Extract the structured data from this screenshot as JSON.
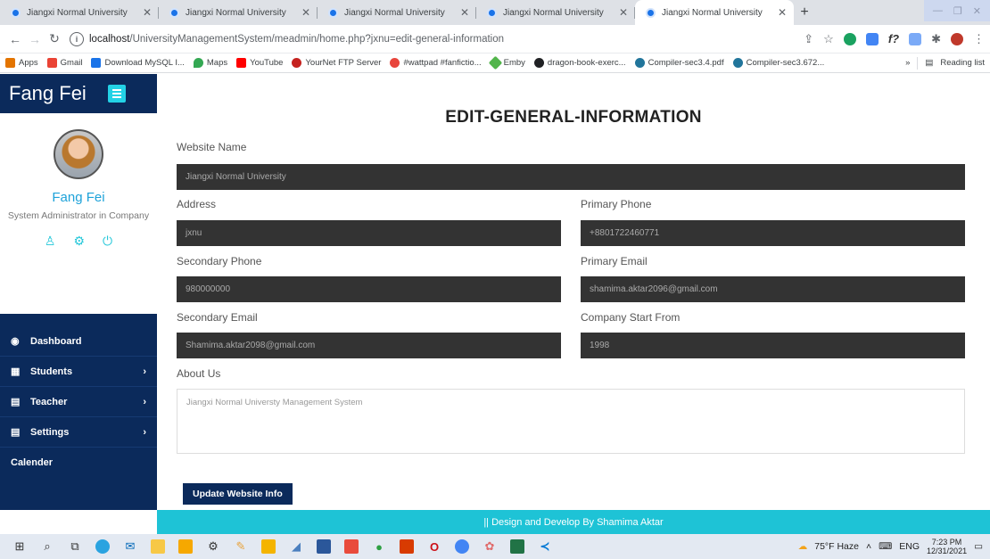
{
  "browser": {
    "tabs": [
      {
        "title": "Jiangxi Normal University",
        "active": false
      },
      {
        "title": "Jiangxi Normal University",
        "active": false
      },
      {
        "title": "Jiangxi Normal University",
        "active": false
      },
      {
        "title": "Jiangxi Normal University",
        "active": false
      },
      {
        "title": "Jiangxi Normal University",
        "active": true
      }
    ],
    "url_host": "localhost",
    "url_path": "/UniversityManagementSystem/meadmin/home.php?jxnu=edit-general-information",
    "bookmarks": [
      {
        "label": "Apps",
        "color": "#e37400"
      },
      {
        "label": "Gmail",
        "color": "#ea4335"
      },
      {
        "label": "Download MySQL I...",
        "color": "#1a73e8"
      },
      {
        "label": "Maps",
        "color": "#34a853"
      },
      {
        "label": "YouTube",
        "color": "#ff0000"
      },
      {
        "label": "YourNet FTP Server",
        "color": "#c5221f"
      },
      {
        "label": "#wattpad #fanfictio...",
        "color": "#e8453c"
      },
      {
        "label": "Emby",
        "color": "#52b54b"
      },
      {
        "label": "dragon-book-exerc...",
        "color": "#202124"
      },
      {
        "label": "Compiler-sec3.4.pdf",
        "color": "#21759b"
      },
      {
        "label": "Compiler-sec3.672...",
        "color": "#21759b"
      }
    ],
    "more_bookmarks": "»",
    "reading_list": "Reading list"
  },
  "sidebar": {
    "brand": "Fang Fei",
    "profile_name": "Fang Fei",
    "profile_role": "System Administrator in Company",
    "nav": [
      {
        "label": "Dashboard",
        "icon": "dashboard-icon",
        "glyph": "◉",
        "chevron": false
      },
      {
        "label": "Students",
        "icon": "table-icon",
        "glyph": "▦",
        "chevron": true
      },
      {
        "label": "Teacher",
        "icon": "file-icon",
        "glyph": "▤",
        "chevron": true
      },
      {
        "label": "Settings",
        "icon": "file-icon",
        "glyph": "▤",
        "chevron": true
      },
      {
        "label": "Calender",
        "icon": "",
        "glyph": "",
        "chevron": false
      }
    ]
  },
  "main": {
    "title": "EDIT-GENERAL-INFORMATION",
    "fields": {
      "website_name": {
        "label": "Website Name",
        "value": "Jiangxi Normal University"
      },
      "address": {
        "label": "Address",
        "value": "jxnu"
      },
      "primary_phone": {
        "label": "Primary Phone",
        "value": "+8801722460771"
      },
      "secondary_phone": {
        "label": "Secondary Phone",
        "value": "980000000"
      },
      "primary_email": {
        "label": "Primary Email",
        "value": "shamima.aktar2096@gmail.com"
      },
      "secondary_email": {
        "label": "Secondary Email",
        "value": "Shamima.aktar2098@gmail.com"
      },
      "company_start": {
        "label": "Company Start From",
        "value": "1998"
      },
      "about_us": {
        "label": "About Us",
        "value": "Jiangxi Normal Universty Management System"
      }
    },
    "update_button": "Update Website Info"
  },
  "footer": {
    "text": "|| Design and Develop By Shamima Aktar"
  },
  "taskbar": {
    "weather": "75°F Haze",
    "language": "ENG",
    "time": "7:23 PM",
    "date": "12/31/2021"
  },
  "colors": {
    "sidebar_bg": "#0b2a5b",
    "accent": "#1ec3d6",
    "input_bg": "#333333"
  }
}
